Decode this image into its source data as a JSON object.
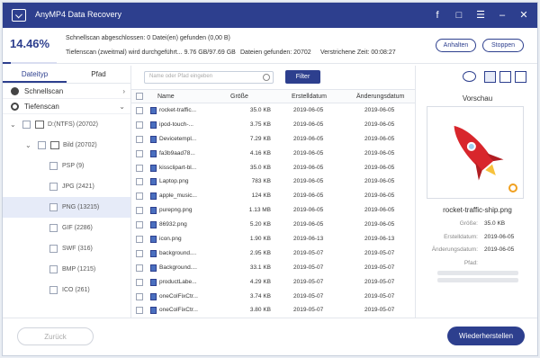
{
  "window": {
    "title": "AnyMP4 Data Recovery"
  },
  "status": {
    "percent": "14.46%",
    "progress": 0.1446,
    "quick_scan": "Schnellscan abgeschlossen: 0 Datei(en) gefunden (0,00  B)",
    "deep_scan": "Tiefenscan (zweitmal) wird durchgeführt... 9.76 GB/97.69 GB",
    "files_found": "Dateien gefunden: 20702",
    "elapsed": "Verstrichene Zeit: 00:08:27",
    "pause_label": "Anhalten",
    "stop_label": "Stoppen"
  },
  "left": {
    "tabs": [
      "Dateityp",
      "Pfad"
    ],
    "quick_scan": "Schnellscan",
    "deep_scan": "Tiefenscan",
    "tree": [
      {
        "label": "D:(NTFS) (20702)"
      },
      {
        "label": "Bild (20702)"
      },
      {
        "label": "PSP (9)"
      },
      {
        "label": "JPG (2421)"
      },
      {
        "label": "PNG (13215)"
      },
      {
        "label": "GIF (2286)"
      },
      {
        "label": "SWF (316)"
      },
      {
        "label": "BMP (1215)"
      },
      {
        "label": "ICO (261)"
      }
    ]
  },
  "center": {
    "search_placeholder": "Name oder Pfad eingeben",
    "filter_label": "Filter",
    "columns": [
      "Name",
      "Größe",
      "Erstelldatum",
      "Änderungsdatum"
    ],
    "rows": [
      [
        "rocket-traffic...",
        "35.0 KB",
        "2019-06-05",
        "2019-06-05"
      ],
      [
        "ipod-touch-...",
        "3.75 KB",
        "2019-06-05",
        "2019-06-05"
      ],
      [
        "Devicetempl...",
        "7.29 KB",
        "2019-06-05",
        "2019-06-05"
      ],
      [
        "fa3b9aad78...",
        "4.16 KB",
        "2019-06-05",
        "2019-06-05"
      ],
      [
        "kissclipart-bl...",
        "35.0 KB",
        "2019-06-05",
        "2019-06-05"
      ],
      [
        "Laptop.png",
        "783 KB",
        "2019-06-05",
        "2019-06-05"
      ],
      [
        "apple_music...",
        "124 KB",
        "2019-06-05",
        "2019-06-05"
      ],
      [
        "purepng.png",
        "1.13 MB",
        "2019-06-05",
        "2019-06-05"
      ],
      [
        "86932.png",
        "5.20 KB",
        "2019-06-05",
        "2019-06-05"
      ],
      [
        "icon.png",
        "1.90 KB",
        "2019-06-13",
        "2019-06-13"
      ],
      [
        "background....",
        "2.95 KB",
        "2019-05-07",
        "2019-05-07"
      ],
      [
        "Background....",
        "33.1 KB",
        "2019-05-07",
        "2019-05-07"
      ],
      [
        "productLabe...",
        "4.29 KB",
        "2019-05-07",
        "2019-05-07"
      ],
      [
        "oneColFixCtr...",
        "3.74 KB",
        "2019-05-07",
        "2019-05-07"
      ],
      [
        "oneColFixCtr...",
        "3.80 KB",
        "2019-05-07",
        "2019-05-07"
      ]
    ]
  },
  "preview": {
    "title": "Vorschau",
    "file_name": "rocket-traffic-ship.png",
    "size_label": "Größe:",
    "size_value": "35.0 KB",
    "created_label": "Erstelldatum:",
    "created_value": "2019-06-05",
    "modified_label": "Änderungsdatum:",
    "modified_value": "2019-06-05",
    "path_label": "Pfad:"
  },
  "bottom": {
    "back_label": "Zurück",
    "restore_label": "Wiederherstellen"
  },
  "colors": {
    "accent": "#2d3f8e",
    "rocket": "#d8262c"
  }
}
